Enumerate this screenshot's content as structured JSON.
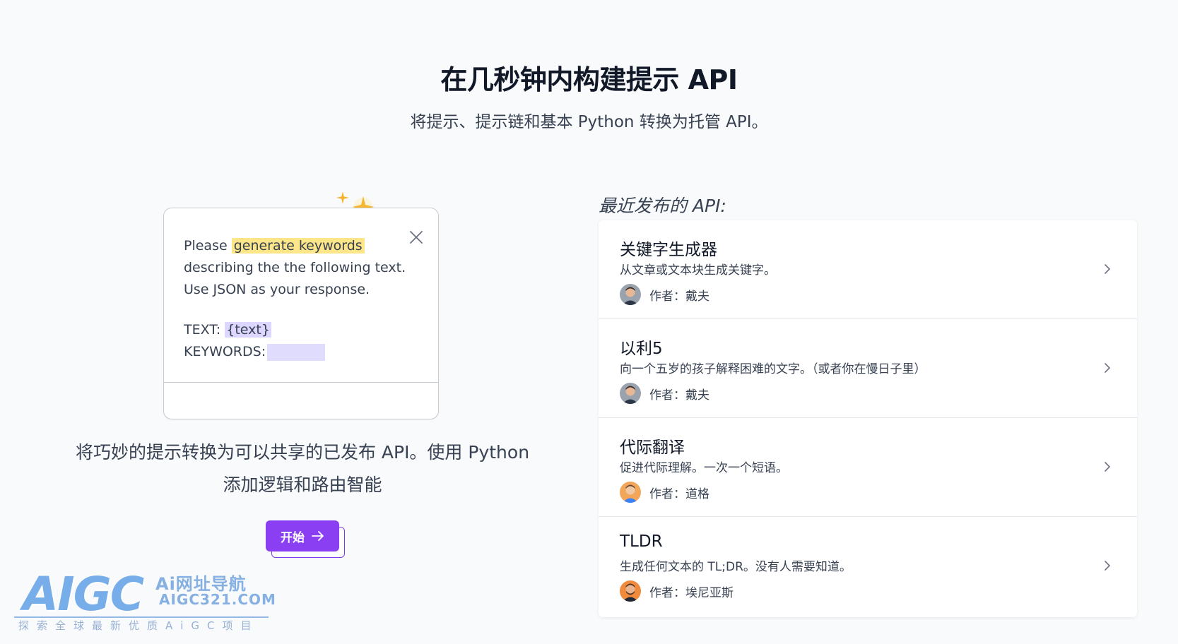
{
  "hero": {
    "title": "在几秒钟内构建提示 API",
    "subtitle": "将提示、提示链和基本 Python 转换为托管 API。"
  },
  "prompt_card": {
    "line1_prefix": "Please ",
    "highlight": "generate keywords",
    "line2": "describing the the following text.",
    "line3": "Use JSON as your response.",
    "text_label": "TEXT: ",
    "text_var": "{text}",
    "keywords_label": "KEYWORDS:"
  },
  "left_description": {
    "line1": "将巧妙的提示转换为可以共享的已发布 API。使用 Python",
    "line2": "添加逻辑和路由智能"
  },
  "start_button": {
    "label": "开始",
    "icon": "arrow-right-icon"
  },
  "recent": {
    "heading": "最近发布的 API:",
    "items": [
      {
        "name": "关键字生成器",
        "description": "从文章或文本块生成关键字。",
        "author": "作者：戴夫",
        "avatar": "avatar-dave"
      },
      {
        "name": "以利5",
        "description": "向一个五岁的孩子解释困难的文字。（或者你在慢日子里）",
        "author": "作者：戴夫",
        "avatar": "avatar-dave"
      },
      {
        "name": "代际翻译",
        "description": "促进代际理解。一次一个短语。",
        "author": "作者：道格",
        "avatar": "avatar-doug"
      },
      {
        "name": "TLDR",
        "description": "生成任何文本的 TL;DR。没有人需要知道。",
        "author": "作者：埃尼亚斯",
        "avatar": "avatar-aeneas"
      }
    ]
  },
  "watermark": {
    "logo": "AIGC",
    "site_name": "Ai网址导航",
    "url": "AIGC321.COM",
    "tagline": "探索全球最新优质AiGC项目"
  },
  "colors": {
    "accent": "#8b3ff2",
    "highlight_yellow": "#fde68a",
    "highlight_purple": "#ddd6fe",
    "sparkle": "#f5b730"
  }
}
